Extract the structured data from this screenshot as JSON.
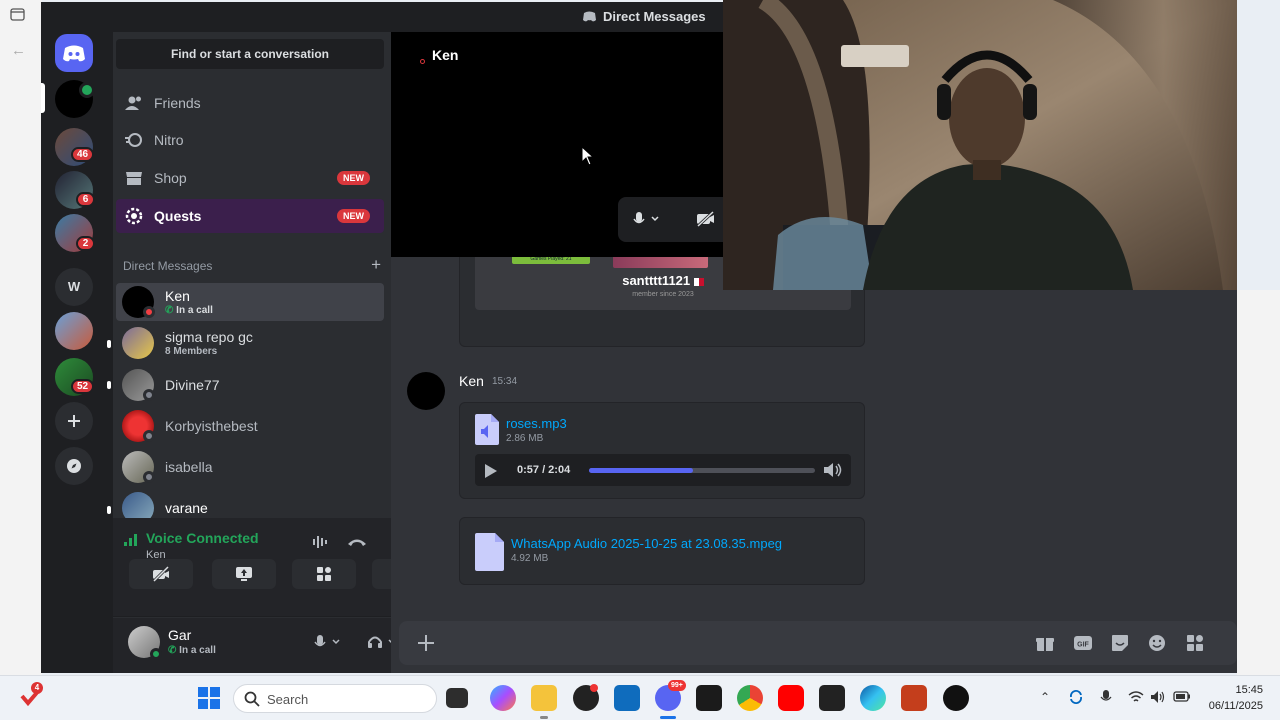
{
  "window": {
    "title": "Direct Messages"
  },
  "servers": {
    "badges": [
      "46",
      "6",
      "2",
      "52"
    ],
    "letter_server": "W"
  },
  "dm_panel": {
    "find_placeholder": "Find or start a conversation",
    "nav": [
      {
        "label": "Friends",
        "icon": "friends-icon"
      },
      {
        "label": "Nitro",
        "icon": "nitro-icon"
      },
      {
        "label": "Shop",
        "icon": "shop-icon",
        "badge": "NEW"
      },
      {
        "label": "Quests",
        "icon": "quests-icon",
        "badge": "NEW",
        "active": true
      }
    ],
    "dm_header": "Direct Messages",
    "dms": [
      {
        "name": "Ken",
        "sub": "In a call",
        "selected": true
      },
      {
        "name": "sigma repo gc",
        "sub": "8 Members"
      },
      {
        "name": "Divine77",
        "sub": ""
      },
      {
        "name": "Korbyisthebest",
        "sub": ""
      },
      {
        "name": "isabella",
        "sub": ""
      },
      {
        "name": "varane",
        "sub": ""
      }
    ]
  },
  "voice": {
    "status": "Voice Connected",
    "channel": "Ken"
  },
  "user": {
    "name": "Gar",
    "status": "In a call"
  },
  "call_popup": {
    "caller": "Ken"
  },
  "messages": {
    "embed": {
      "username": "santttt1121",
      "member_since": "member since 2023",
      "games_played": "Games Played: 21"
    },
    "author": "Ken",
    "timestamp": "15:34",
    "audio_file": {
      "name": "roses.mp3",
      "size": "2.86 MB",
      "time": "0:57 / 2:04",
      "progress": 0.46
    },
    "file": {
      "name": "WhatsApp Audio 2025-10-25 at 23.08.35.mpeg",
      "size": "4.92 MB"
    }
  },
  "taskbar": {
    "search_placeholder": "Search",
    "time": "15:45",
    "date": "06/11/2025",
    "notify_badge": "4",
    "discord_badge": "99+"
  },
  "colors": {
    "accent": "#5865f2",
    "green": "#23a55a",
    "red": "#da373c",
    "quests_bg": "#3b1f4c"
  }
}
